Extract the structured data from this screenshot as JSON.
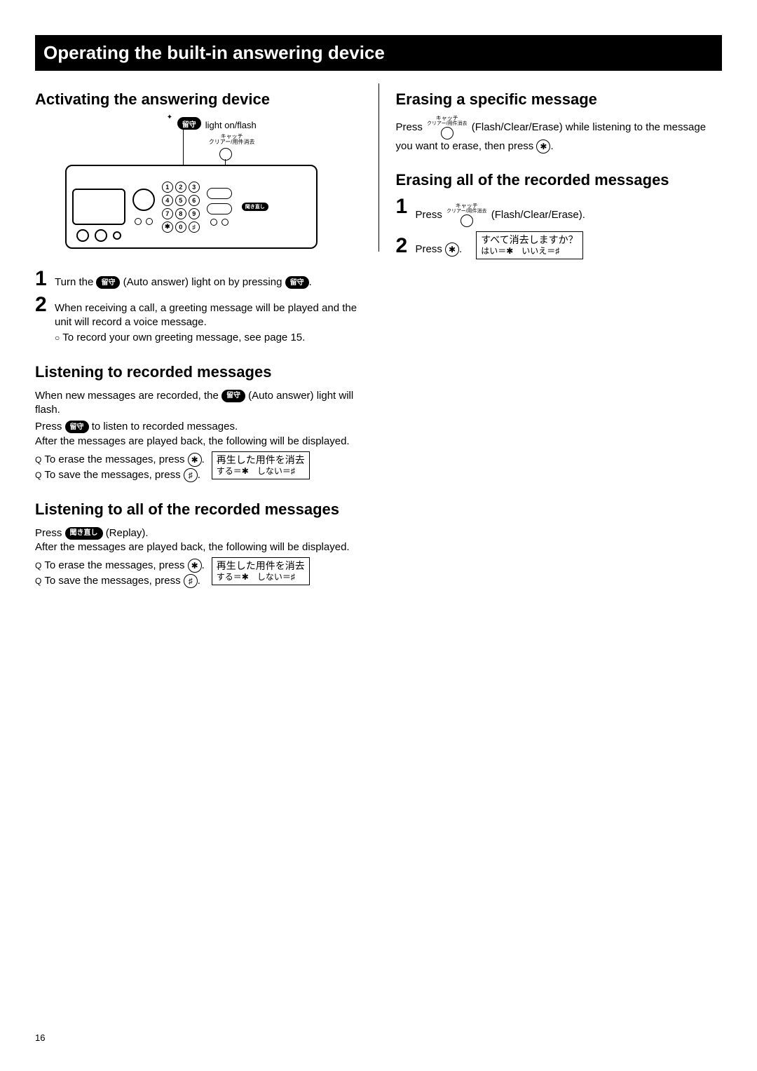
{
  "pageNumber": "16",
  "titleBar": "Operating the built-in answering device",
  "left": {
    "section1": {
      "heading": "Activating the answering device",
      "diagram": {
        "lightLabel": "light on/flash",
        "rusuLabel": "留守",
        "catchLabel1": "キャッチ",
        "catchLabel2": "クリアー/用件消去",
        "replayLabel": "聞き直し",
        "keys": [
          "1",
          "2",
          "3",
          "4",
          "5",
          "6",
          "7",
          "8",
          "9",
          "✱",
          "0",
          "♯"
        ]
      },
      "step1": {
        "num": "1",
        "pre": "Turn the ",
        "btn1": "留守",
        "mid": " (Auto answer) light on by pressing ",
        "btn2": "留守",
        "post": "."
      },
      "step2": {
        "num": "2",
        "text": "When receiving a call, a greeting message will be played and the unit will record a voice message.",
        "note": "To record your own greeting message, see page 15."
      }
    },
    "section2": {
      "heading": "Listening to recorded messages",
      "para1pre": "When new messages are recorded, the ",
      "para1btn": "留守",
      "para1post": " (Auto answer) light will flash.",
      "para2pre": "Press ",
      "para2btn": "留守",
      "para2post": " to listen to recorded messages.",
      "para3": "After the messages are played back, the following will be displayed.",
      "bullet1pre": "To erase the messages, press ",
      "bullet1sym": "✱",
      "bullet1post": ".",
      "bullet2pre": "To save the messages, press ",
      "bullet2sym": "♯",
      "bullet2post": ".",
      "display": {
        "line1": "再生した用件を消去",
        "line2": "する＝✱　しない＝♯"
      }
    },
    "section3": {
      "heading": "Listening to all of the recorded messages",
      "para1pre": "Press ",
      "para1btn": "聞き直し",
      "para1post": " (Replay).",
      "para2": "After the messages are played back, the following will be displayed.",
      "bullet1pre": "To erase the messages, press ",
      "bullet1sym": "✱",
      "bullet1post": ".",
      "bullet2pre": "To save the messages, press ",
      "bullet2sym": "♯",
      "bullet2post": ".",
      "display": {
        "line1": "再生した用件を消去",
        "line2": "する＝✱　しない＝♯"
      }
    }
  },
  "right": {
    "section1": {
      "heading": "Erasing a specific message",
      "pre": "Press ",
      "btnLabel1": "キャッチ",
      "btnLabel2": "クリアー/用件消去",
      "mid": " (Flash/Clear/Erase) while listening to the message you want to erase, then press ",
      "sym": "✱",
      "post": "."
    },
    "section2": {
      "heading": "Erasing all of the recorded messages",
      "step1": {
        "num": "1",
        "pre": "Press ",
        "btnLabel1": "キャッチ",
        "btnLabel2": "クリアー/用件消去",
        "post": " (Flash/Clear/Erase)."
      },
      "step2": {
        "num": "2",
        "pre": "Press ",
        "sym": "✱",
        "post": "."
      },
      "display": {
        "line1": "すべて消去しますか？",
        "line2": "はい＝✱　いいえ＝♯"
      }
    }
  }
}
